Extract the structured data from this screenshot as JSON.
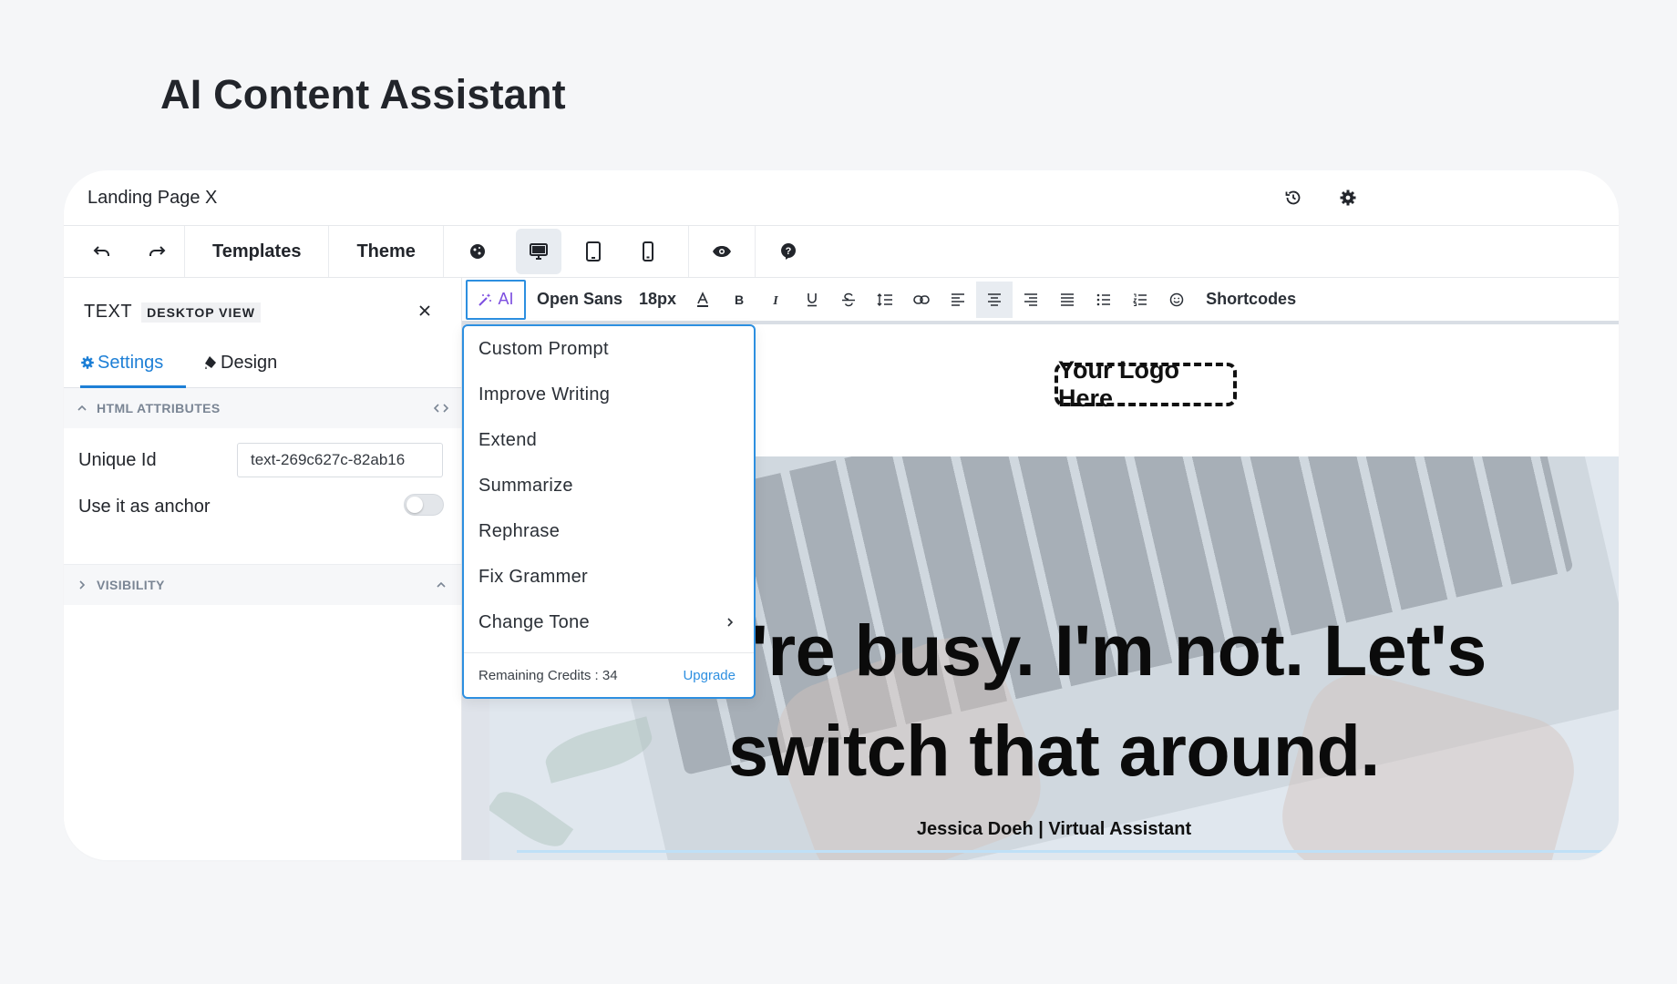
{
  "page": {
    "heading": "AI Content Assistant"
  },
  "window": {
    "title": "Landing Page X"
  },
  "toolbar": {
    "templates_label": "Templates",
    "theme_label": "Theme"
  },
  "left_panel": {
    "element_type": "TEXT",
    "view_label": "DESKTOP VIEW",
    "tabs": [
      {
        "label": "Settings"
      },
      {
        "label": "Design"
      }
    ],
    "html_attributes": {
      "section_label": "HTML ATTRIBUTES"
    },
    "unique_id": {
      "label": "Unique Id",
      "value": "text-269c627c-82ab16"
    },
    "anchor": {
      "label": "Use it as anchor",
      "enabled": false
    },
    "visibility": {
      "section_label": "VISIBILITY"
    }
  },
  "format_bar": {
    "ai_label": "AI",
    "font_family": "Open Sans",
    "font_size": "18px",
    "shortcodes_label": "Shortcodes",
    "text_align": "center"
  },
  "ai_menu": {
    "items": [
      {
        "label": "Custom Prompt"
      },
      {
        "label": "Improve Writing"
      },
      {
        "label": "Extend"
      },
      {
        "label": "Summarize"
      },
      {
        "label": "Rephrase"
      },
      {
        "label": "Fix Grammer"
      },
      {
        "label": "Change Tone",
        "has_submenu": true
      }
    ],
    "credits_text": "Remaining Credits : 34",
    "upgrade_label": "Upgrade"
  },
  "preview": {
    "logo_text": "Your Logo Here",
    "headline_line1": "You're busy. I'm not. Let's",
    "headline_line2": "switch that around.",
    "byline": "Jessica Doeh | Virtual Assistant"
  },
  "colors": {
    "accent": "#2d8fe0",
    "ai_purple": "#7d4fe0",
    "active_tab": "#1d7fd6"
  }
}
